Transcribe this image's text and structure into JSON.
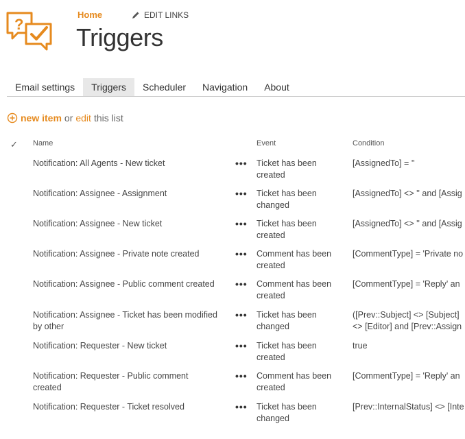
{
  "header": {
    "breadcrumb_home": "Home",
    "edit_links": "EDIT LINKS",
    "title": "Triggers"
  },
  "tabs": [
    {
      "label": "Email settings",
      "active": false
    },
    {
      "label": "Triggers",
      "active": true
    },
    {
      "label": "Scheduler",
      "active": false
    },
    {
      "label": "Navigation",
      "active": false
    },
    {
      "label": "About",
      "active": false
    }
  ],
  "list_actions": {
    "new_item": "new item",
    "or": "or",
    "edit": "edit",
    "this_list": "this list"
  },
  "table": {
    "columns": {
      "check": "✓",
      "name": "Name",
      "event": "Event",
      "condition": "Condition"
    },
    "rows": [
      {
        "name": "Notification: All Agents - New ticket",
        "event": "Ticket has been created",
        "condition": "[AssignedTo] = ''"
      },
      {
        "name": "Notification: Assignee - Assignment",
        "event": "Ticket has been changed",
        "condition": "[AssignedTo] <> '' and [Assig"
      },
      {
        "name": "Notification: Assignee - New ticket",
        "event": "Ticket has been created",
        "condition": "[AssignedTo] <> '' and [Assig"
      },
      {
        "name": "Notification: Assignee - Private note created",
        "event": "Comment has been created",
        "condition": "[CommentType] = 'Private no"
      },
      {
        "name": "Notification: Assignee - Public comment created",
        "event": "Comment has been created",
        "condition": "[CommentType] = 'Reply' an"
      },
      {
        "name": "Notification: Assignee - Ticket has been modified by other",
        "event": "Ticket has been changed",
        "condition": "([Prev::Subject] <> [Subject] <> [Editor] and [Prev::Assign"
      },
      {
        "name": "Notification: Requester - New ticket",
        "event": "Ticket has been created",
        "condition": "true"
      },
      {
        "name": "Notification: Requester - Public comment created",
        "event": "Comment has been created",
        "condition": "[CommentType] = 'Reply' an"
      },
      {
        "name": "Notification: Requester - Ticket resolved",
        "event": "Ticket has been changed",
        "condition": "[Prev::InternalStatus] <> [Inte"
      }
    ]
  },
  "colors": {
    "accent": "#e68a1e",
    "text": "#444444",
    "tab_active_bg": "#e8e8e8"
  },
  "icons": {
    "logo": "help-desk-logo-icon",
    "edit": "pencil-icon",
    "add": "plus-circle-icon",
    "more": "ellipsis-icon"
  }
}
